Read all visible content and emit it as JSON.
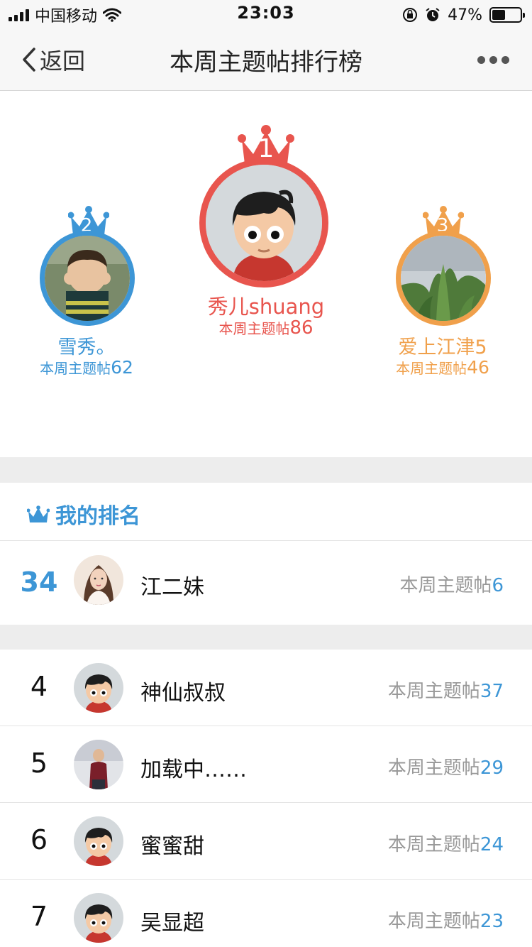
{
  "status_bar": {
    "carrier": "中国移动",
    "time": "23:03",
    "battery_text": "47%",
    "battery_level": 0.47
  },
  "nav": {
    "back_label": "返回",
    "title": "本周主题帖排行榜"
  },
  "podium": [
    {
      "rank": "1",
      "name": "秀儿shuang",
      "stat_label": "本周主题帖",
      "stat_value": "86",
      "color": "#e8554e"
    },
    {
      "rank": "2",
      "name": "雪秀。",
      "stat_label": "本周主题帖",
      "stat_value": "62",
      "color": "#3d96d6"
    },
    {
      "rank": "3",
      "name": "爱上江津5",
      "stat_label": "本周主题帖",
      "stat_value": "46",
      "color": "#f0a04b"
    }
  ],
  "my_ranking": {
    "header": "我的排名",
    "rank": "34",
    "name": "江二妹",
    "stat_label": "本周主题帖",
    "stat_value": "6"
  },
  "list": [
    {
      "rank": "4",
      "name": "神仙叔叔",
      "stat_label": "本周主题帖",
      "stat_value": "37"
    },
    {
      "rank": "5",
      "name": "加载中……",
      "stat_label": "本周主题帖",
      "stat_value": "29"
    },
    {
      "rank": "6",
      "name": "蜜蜜甜",
      "stat_label": "本周主题帖",
      "stat_value": "24"
    },
    {
      "rank": "7",
      "name": "吴显超",
      "stat_label": "本周主题帖",
      "stat_value": "23"
    }
  ],
  "colors": {
    "accent": "#3d96d6",
    "gold": "#e8554e",
    "silver": "#3d96d6",
    "bronze": "#f0a04b"
  }
}
